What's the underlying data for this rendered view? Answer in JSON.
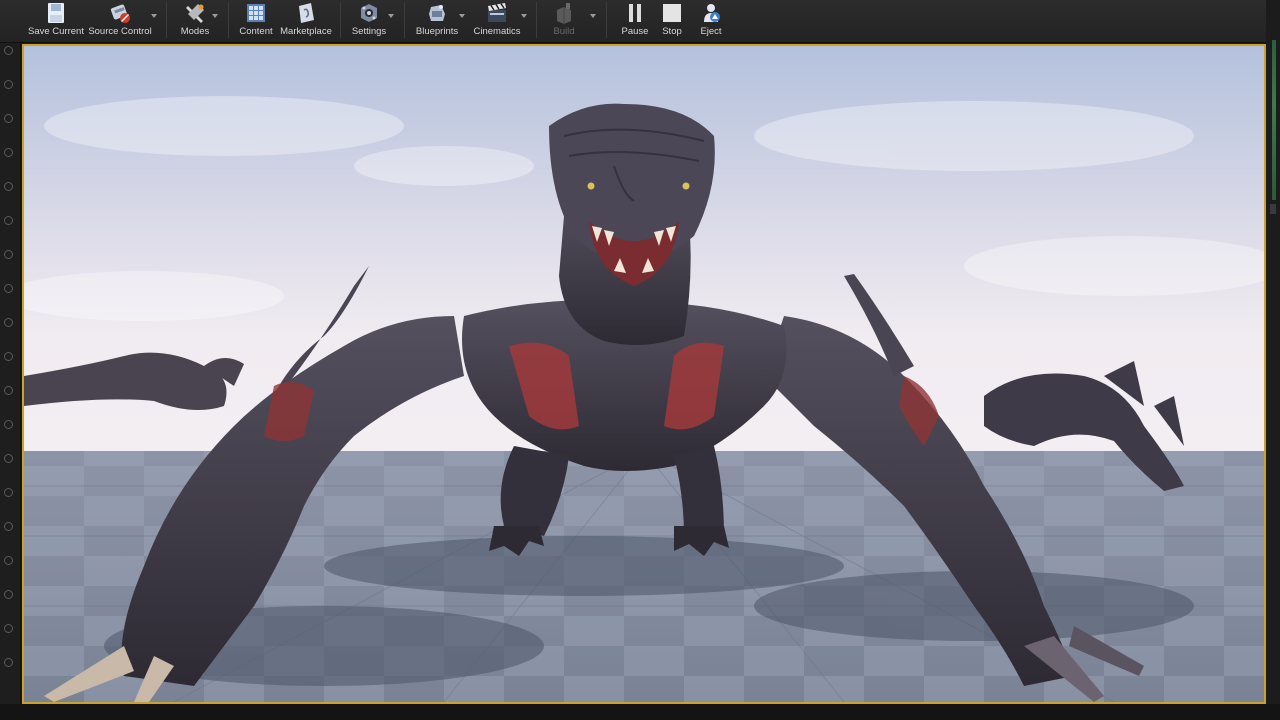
{
  "toolbar": {
    "items": [
      {
        "label": "Save Current",
        "icon": "save-icon"
      },
      {
        "label": "Source Control",
        "icon": "source-control-icon"
      },
      {
        "label": "Modes",
        "icon": "modes-icon"
      },
      {
        "label": "Content",
        "icon": "content-icon"
      },
      {
        "label": "Marketplace",
        "icon": "marketplace-icon"
      },
      {
        "label": "Settings",
        "icon": "settings-icon"
      },
      {
        "label": "Blueprints",
        "icon": "blueprints-icon"
      },
      {
        "label": "Cinematics",
        "icon": "cinematics-icon"
      },
      {
        "label": "Build",
        "icon": "build-icon",
        "disabled": true
      },
      {
        "label": "Pause",
        "icon": "pause-icon"
      },
      {
        "label": "Stop",
        "icon": "stop-icon"
      },
      {
        "label": "Eject",
        "icon": "eject-icon"
      }
    ]
  },
  "viewport": {
    "subject": "dragon-creature",
    "colors": {
      "sky_top": "#b9c4de",
      "sky_bottom": "#ece8ef",
      "floor_light": "#9aa2b6",
      "floor_dark": "#7c8498",
      "creature": "#3a3642",
      "creature_red": "#a03a3c",
      "border": "#c9a227"
    }
  }
}
